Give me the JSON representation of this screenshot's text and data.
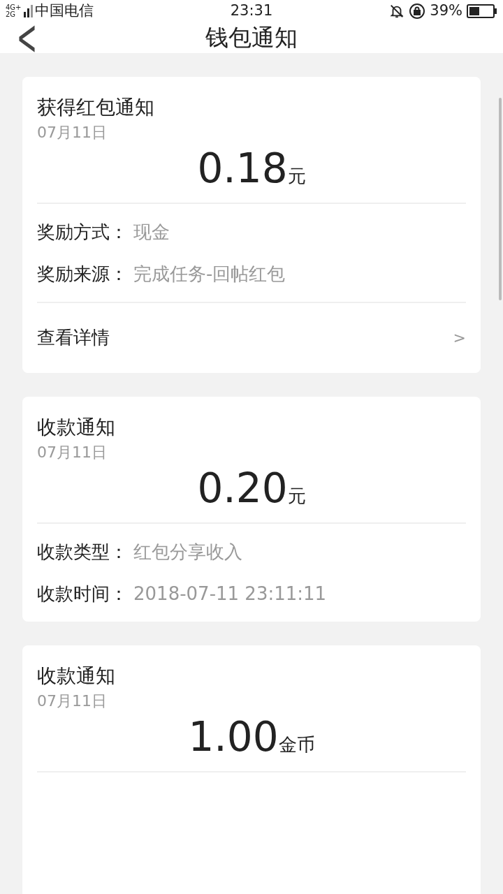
{
  "status_bar": {
    "network": "4G+ 2G",
    "carrier": "中国电信",
    "time": "23:31",
    "battery": "39%"
  },
  "header": {
    "back": "<",
    "title": "钱包通知"
  },
  "cards": [
    {
      "title": "获得红包通知",
      "date": "07月11日",
      "amount": "0.18",
      "unit": "元",
      "fields": [
        {
          "label": "奖励方式：",
          "value": "现金"
        },
        {
          "label": "奖励来源：",
          "value": "完成任务-回帖红包"
        }
      ],
      "link": {
        "label": "查看详情",
        "chevron": ">"
      }
    },
    {
      "title": "收款通知",
      "date": "07月11日",
      "amount": "0.20",
      "unit": "元",
      "fields": [
        {
          "label": "收款类型：",
          "value": "红包分享收入"
        },
        {
          "label": "收款时间：",
          "value": "2018-07-11 23:11:11"
        }
      ]
    },
    {
      "title": "收款通知",
      "date": "07月11日",
      "amount": "1.00",
      "unit": "金币"
    }
  ]
}
